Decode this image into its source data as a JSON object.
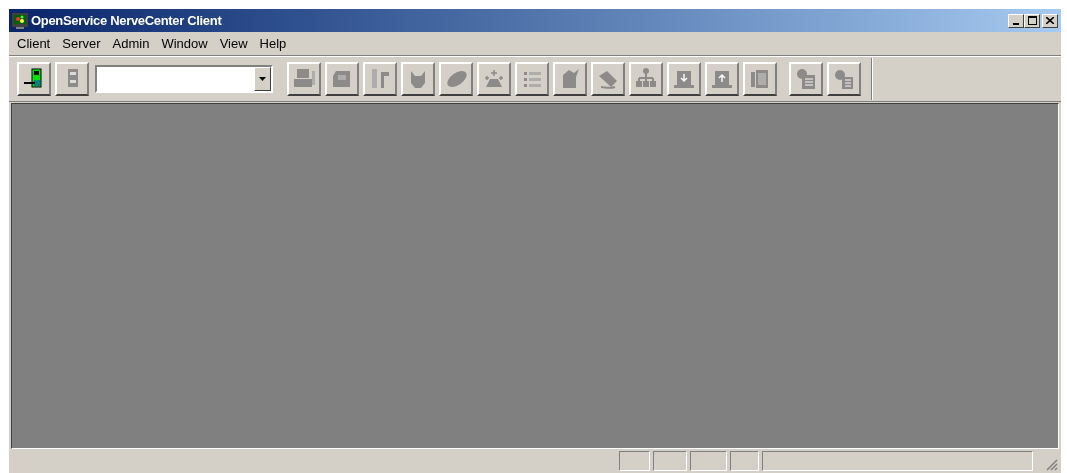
{
  "window": {
    "title": "OpenService NerveCenter Client"
  },
  "menu": [
    "Client",
    "Server",
    "Admin",
    "Window",
    "View",
    "Help"
  ],
  "toolbar": {
    "groups": [
      [
        {
          "disabled": false
        },
        {
          "disabled": true
        }
      ],
      [
        {
          "disabled": true
        },
        {
          "disabled": true
        },
        {
          "disabled": true
        },
        {
          "disabled": true
        },
        {
          "disabled": true
        },
        {
          "disabled": true
        },
        {
          "disabled": true
        },
        {
          "disabled": true
        },
        {
          "disabled": true
        },
        {
          "disabled": true
        },
        {
          "disabled": true
        },
        {
          "disabled": true
        },
        {
          "disabled": true
        }
      ],
      [
        {
          "disabled": true
        },
        {
          "disabled": true
        }
      ]
    ]
  }
}
